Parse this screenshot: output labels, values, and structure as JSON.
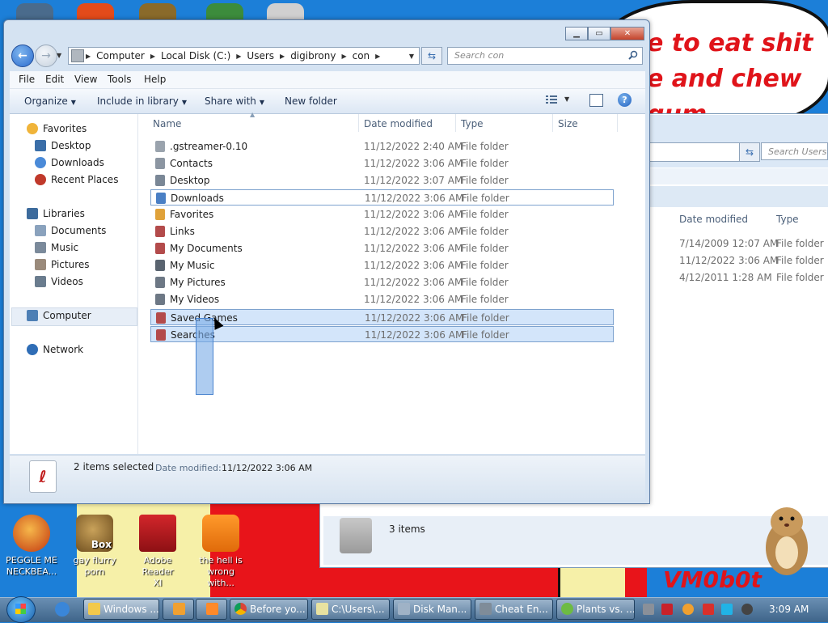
{
  "wallpaper": {
    "speech_lines": [
      "e to eat shit",
      "e and chew",
      "gum"
    ],
    "watermark": "VM0b0t"
  },
  "back_window": {
    "search_placeholder": "Search Users",
    "columns": [
      "Date modified",
      "Type"
    ],
    "rows": [
      {
        "date": "7/14/2009 12:07 AM",
        "type": "File folder"
      },
      {
        "date": "11/12/2022 3:06 AM",
        "type": "File folder"
      },
      {
        "date": "4/12/2011 1:28 AM",
        "type": "File folder"
      }
    ],
    "status": "3 items"
  },
  "window": {
    "breadcrumb": [
      "Computer",
      "Local Disk (C:)",
      "Users",
      "digibrony",
      "con"
    ],
    "search_placeholder": "Search con",
    "menu": [
      "File",
      "Edit",
      "View",
      "Tools",
      "Help"
    ],
    "toolbar": {
      "organize": "Organize",
      "include": "Include in library",
      "share": "Share with",
      "new_folder": "New folder"
    },
    "nav": {
      "favorites": "Favorites",
      "desktop": "Desktop",
      "downloads": "Downloads",
      "recent": "Recent Places",
      "libraries": "Libraries",
      "documents": "Documents",
      "music": "Music",
      "pictures": "Pictures",
      "videos": "Videos",
      "computer": "Computer",
      "network": "Network"
    },
    "columns": {
      "name": "Name",
      "date": "Date modified",
      "type": "Type",
      "size": "Size"
    },
    "files": [
      {
        "name": ".gstreamer-0.10",
        "date": "11/12/2022 2:40 AM",
        "type": "File folder"
      },
      {
        "name": "Contacts",
        "date": "11/12/2022 3:06 AM",
        "type": "File folder"
      },
      {
        "name": "Desktop",
        "date": "11/12/2022 3:07 AM",
        "type": "File folder"
      },
      {
        "name": "Downloads",
        "date": "11/12/2022 3:06 AM",
        "type": "File folder"
      },
      {
        "name": "Favorites",
        "date": "11/12/2022 3:06 AM",
        "type": "File folder"
      },
      {
        "name": "Links",
        "date": "11/12/2022 3:06 AM",
        "type": "File folder"
      },
      {
        "name": "My Documents",
        "date": "11/12/2022 3:06 AM",
        "type": "File folder"
      },
      {
        "name": "My Music",
        "date": "11/12/2022 3:06 AM",
        "type": "File folder"
      },
      {
        "name": "My Pictures",
        "date": "11/12/2022 3:06 AM",
        "type": "File folder"
      },
      {
        "name": "My Videos",
        "date": "11/12/2022 3:06 AM",
        "type": "File folder"
      },
      {
        "name": "Saved Games",
        "date": "11/12/2022 3:06 AM",
        "type": "File folder"
      },
      {
        "name": "Searches",
        "date": "11/12/2022 3:06 AM",
        "type": "File folder"
      }
    ],
    "details": {
      "count": "2 items selected",
      "label": "Date modified:",
      "value": "11/12/2022 3:06 AM"
    }
  },
  "desktop_icons": [
    {
      "line1": "PEGGLE ME",
      "line2": "NECKBEA..."
    },
    {
      "line1": "gay flurry",
      "line2": "porn",
      "badge": "Box"
    },
    {
      "line1": "Adobe Reader",
      "line2": "XI"
    },
    {
      "line1": "the hell is",
      "line2": "wrong with..."
    }
  ],
  "taskbar": {
    "buttons": [
      "Windows ...",
      "",
      "",
      "Before yo...",
      "C:\\Users\\...",
      "Disk Man...",
      "Cheat En...",
      "Plants vs. ..."
    ],
    "clock": "3:09 AM"
  }
}
